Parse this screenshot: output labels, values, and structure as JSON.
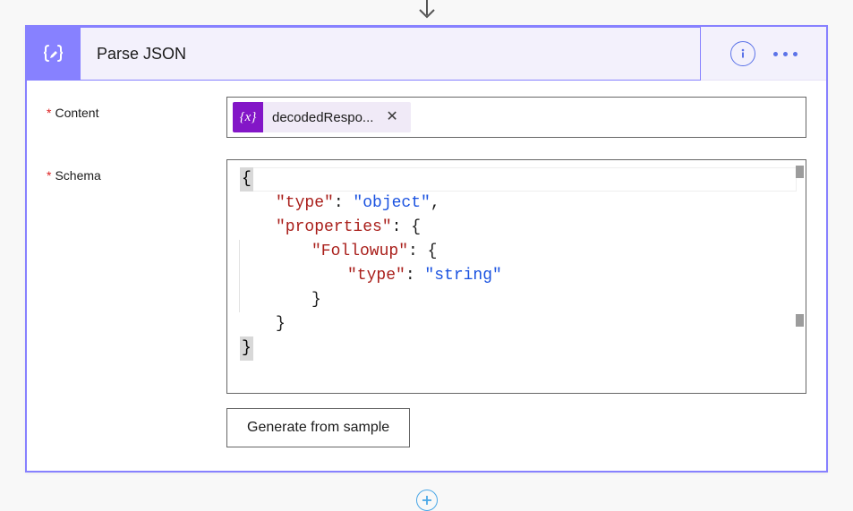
{
  "action": {
    "title": "Parse JSON"
  },
  "fields": {
    "content": {
      "label": "Content",
      "token": {
        "name": "decodedRespo...",
        "icon_text": "{x}"
      }
    },
    "schema": {
      "label": "Schema",
      "json": {
        "open": "{",
        "line_type_key": "\"type\"",
        "line_type_val": "\"object\"",
        "line_props_key": "\"properties\"",
        "line_followup_key": "\"Followup\"",
        "line_inner_type_key": "\"type\"",
        "line_inner_type_val": "\"string\"",
        "close_inner1": "}",
        "close_inner2": "}",
        "close": "}"
      }
    }
  },
  "buttons": {
    "generate": "Generate from sample"
  },
  "required_marker": "*"
}
